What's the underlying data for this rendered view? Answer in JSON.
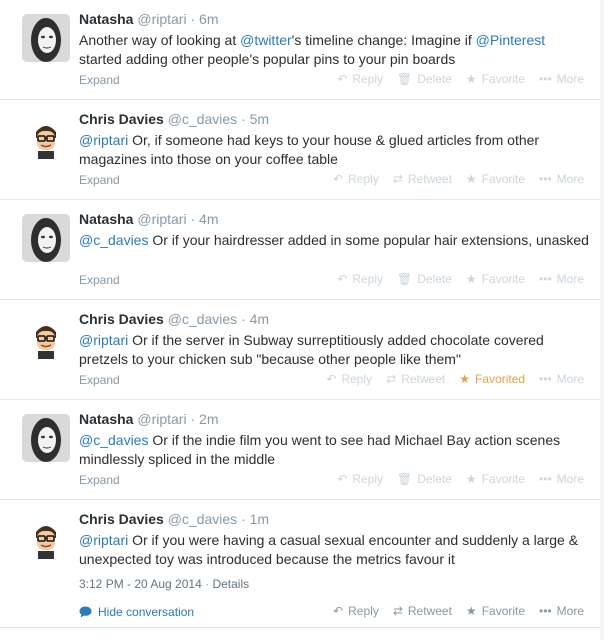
{
  "labels": {
    "expand": "Expand",
    "reply": "Reply",
    "delete": "Delete",
    "retweet": "Retweet",
    "favorite": "Favorite",
    "favorited": "Favorited",
    "more": "More",
    "details": "Details",
    "hide_conversation": "Hide conversation",
    "dot": "·"
  },
  "tweets": [
    {
      "fullname": "Natasha",
      "screen_name": "@riptari",
      "time": "6m",
      "parts": [
        "Another way of looking at ",
        "@twitter",
        "'s timeline change: Imagine if ",
        "@Pinterest",
        " started adding other people's popular pins to your pin boards"
      ]
    },
    {
      "fullname": "Chris Davies",
      "screen_name": "@c_davies",
      "time": "5m",
      "parts": [
        "@riptari",
        " Or, if someone had keys to your house & glued articles from other magazines into those on your coffee table"
      ]
    },
    {
      "fullname": "Natasha",
      "screen_name": "@riptari",
      "time": "4m",
      "parts": [
        "@c_davies",
        " Or if your hairdresser added in some popular hair extensions, unasked"
      ]
    },
    {
      "fullname": "Chris Davies",
      "screen_name": "@c_davies",
      "time": "4m",
      "parts": [
        "@riptari",
        " Or if the server in Subway surreptitiously added chocolate covered pretzels to your chicken sub \"because other people like them\""
      ]
    },
    {
      "fullname": "Natasha",
      "screen_name": "@riptari",
      "time": "2m",
      "parts": [
        "@c_davies",
        " Or if the indie film you went to see had Michael Bay action scenes mindlessly spliced in the middle"
      ]
    },
    {
      "fullname": "Chris Davies",
      "screen_name": "@c_davies",
      "time": "1m",
      "parts": [
        "@riptari",
        " Or if you were having a casual sexual encounter and suddenly a large & unexpected toy was introduced because the metrics favour it"
      ],
      "timestamp": "3:12 PM - 20 Aug 2014"
    }
  ],
  "colors": {
    "link": "#2b7bb9",
    "muted": "#8899a6",
    "action_disabled": "#ccd6dd",
    "favorited": "#e0a34a"
  },
  "icons": [
    "reply-icon",
    "delete-icon",
    "retweet-icon",
    "favorite-star-icon",
    "more-dots-icon",
    "conversation-bubble-icon"
  ]
}
